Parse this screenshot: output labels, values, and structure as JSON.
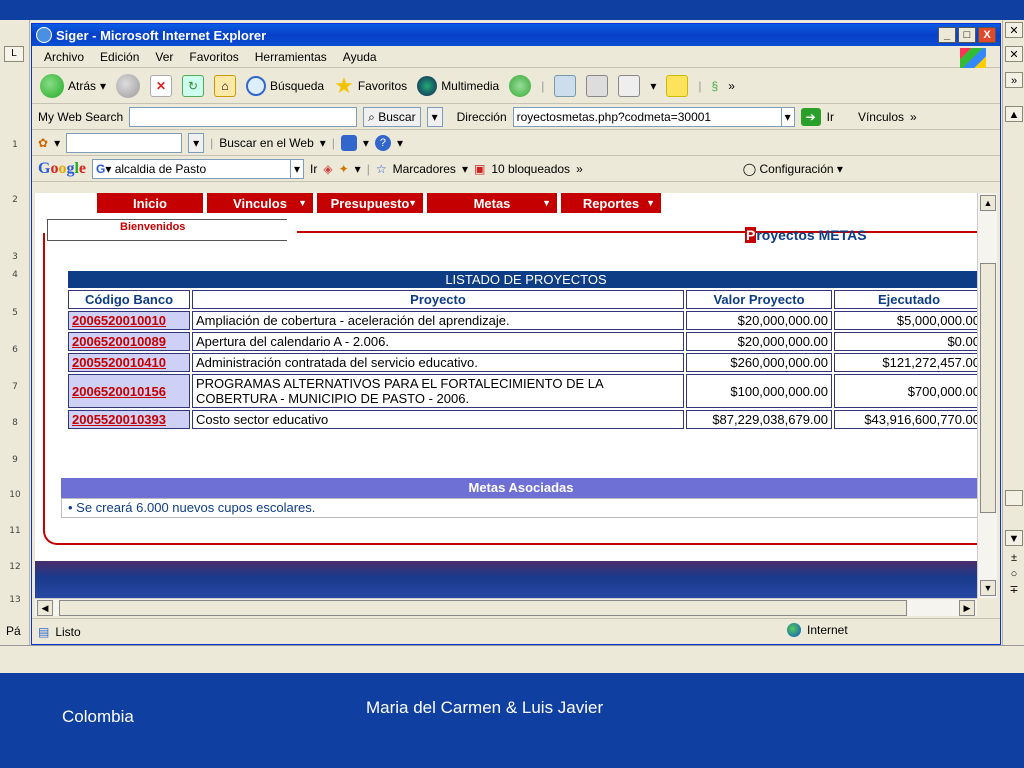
{
  "window": {
    "title": "Siger - Microsoft Internet Explorer",
    "min": "_",
    "max": "□",
    "close": "X"
  },
  "menu": [
    "Archivo",
    "Edición",
    "Ver",
    "Favoritos",
    "Herramientas",
    "Ayuda"
  ],
  "toolbar": {
    "back": "Atrás",
    "search": "Búsqueda",
    "favorites": "Favoritos",
    "multimedia": "Multimedia",
    "more": "»"
  },
  "search_bar": {
    "label": "My Web Search",
    "button": "Buscar",
    "address_label": "Dirección",
    "address": "royectosmetas.php?codmeta=30001",
    "go": "Ir",
    "links": "Vínculos",
    "more": "»"
  },
  "row3": {
    "web_search": "Buscar en el Web"
  },
  "google_bar": {
    "logo": "Google",
    "query": "alcaldia de Pasto",
    "go": "Ir",
    "bookmarks": "Marcadores",
    "blocked": "10 bloqueados",
    "more": "»",
    "settings": "Configuración"
  },
  "nav": [
    {
      "label": "Inicio"
    },
    {
      "label": "Vinculos"
    },
    {
      "label": "Presupuesto"
    },
    {
      "label": "Metas"
    },
    {
      "label": "Reportes"
    }
  ],
  "welcome": "Bienvenidos",
  "page_title": {
    "initial": "P",
    "rest": "royectos METAS"
  },
  "projects": {
    "title": "LISTADO DE PROYECTOS",
    "headers": [
      "Código Banco",
      "Proyecto",
      "Valor Proyecto",
      "Ejecutado"
    ],
    "rows": [
      {
        "code": "2006520010010",
        "name": "Ampliación de cobertura - aceleración del aprendizaje.",
        "value": "$20,000,000.00",
        "executed": "$5,000,000.00"
      },
      {
        "code": "2006520010089",
        "name": "Apertura del calendario A - 2.006.",
        "value": "$20,000,000.00",
        "executed": "$0.00"
      },
      {
        "code": "2005520010410",
        "name": "Administración contratada del servicio educativo.",
        "value": "$260,000,000.00",
        "executed": "$121,272,457.00"
      },
      {
        "code": "2006520010156",
        "name": "PROGRAMAS ALTERNATIVOS PARA EL FORTALECIMIENTO DE LA",
        "name2": "COBERTURA - MUNICIPIO DE PASTO - 2006.",
        "value": "$100,000,000.00",
        "executed": "$700,000.00"
      },
      {
        "code": "2005520010393",
        "name": "Costo sector educativo",
        "value": "$87,229,038,679.00",
        "executed": "$43,916,600,770.00"
      }
    ]
  },
  "metas": {
    "title": "Metas Asociadas",
    "item": "•  Se creará 6.000 nuevos cupos escolares."
  },
  "status": {
    "text": "Listo",
    "zone": "Internet"
  },
  "word": {
    "pa": "Pá"
  },
  "slide": {
    "footer_left": "Colombia",
    "footer_center": "Maria del Carmen & Luis Javier"
  }
}
